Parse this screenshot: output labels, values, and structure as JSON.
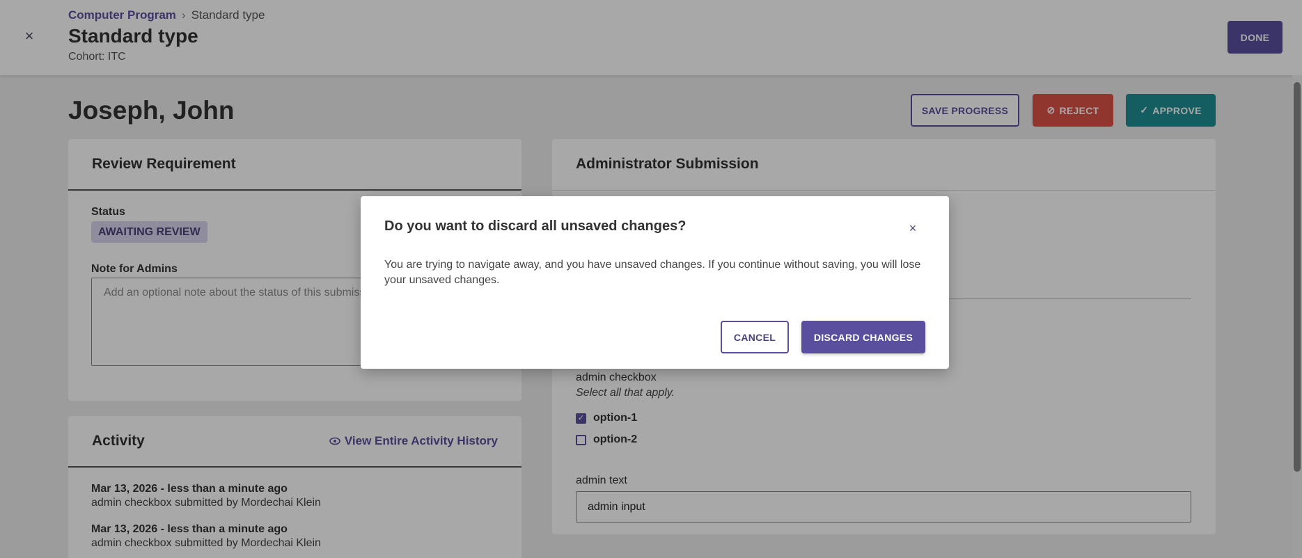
{
  "header": {
    "breadcrumb_link": "Computer Program",
    "breadcrumb_sep": "›",
    "breadcrumb_current": "Standard type",
    "title": "Standard type",
    "cohort": "Cohort: ITC",
    "done_label": "DONE",
    "close_glyph": "×"
  },
  "main": {
    "person_name": "Joseph, John",
    "save_label": "SAVE PROGRESS",
    "reject_label": "REJECT",
    "approve_label": "APPROVE",
    "reject_glyph": "⊘",
    "approve_glyph": "✓"
  },
  "review": {
    "heading": "Review Requirement",
    "status_label": "Status",
    "status_value": "AWAITING REVIEW",
    "note_label": "Note for Admins",
    "note_placeholder": "Add an optional note about the status of this submission"
  },
  "submission": {
    "heading": "Administrator Submission",
    "checkbox_title": "admin checkbox",
    "checkbox_hint": "Select all that apply.",
    "options": [
      {
        "label": "option-1",
        "checked": true
      },
      {
        "label": "option-2",
        "checked": false
      }
    ],
    "text_label": "admin text",
    "text_value": "admin input"
  },
  "activity": {
    "heading": "Activity",
    "view_history_label": "View Entire Activity History",
    "items": [
      {
        "date": "Mar 13, 2026 - less than a minute ago",
        "desc": "admin checkbox submitted by Mordechai Klein"
      },
      {
        "date": "Mar 13, 2026 - less than a minute ago",
        "desc": "admin checkbox submitted by Mordechai Klein"
      }
    ]
  },
  "modal": {
    "title": "Do you want to discard all unsaved changes?",
    "close_glyph": "×",
    "body": "You are trying to navigate away, and you have unsaved changes. If you continue without saving, you will lose your unsaved changes.",
    "cancel_label": "CANCEL",
    "discard_label": "DISCARD CHANGES"
  },
  "colors": {
    "primary": "#5a4f9e",
    "reject": "#dd5248",
    "approve": "#1f8f95",
    "badge_bg": "#d9d6ef"
  }
}
